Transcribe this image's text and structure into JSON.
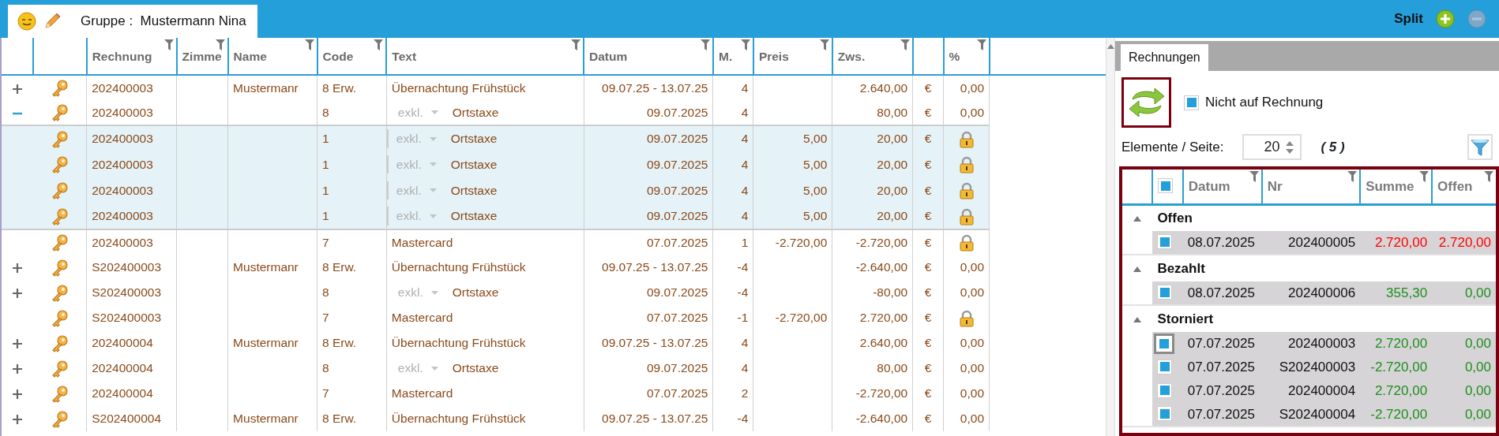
{
  "tab": {
    "title": "Gruppe :  Mustermann Nina"
  },
  "toolbar": {
    "label": "Split",
    "buttons": [
      {
        "kind": "add",
        "disabled": false
      },
      {
        "kind": "remove",
        "disabled": true
      }
    ]
  },
  "grid": {
    "columns": [
      {
        "filter": false
      },
      {
        "filter": false
      },
      {
        "label": "Rechnung",
        "filter": true
      },
      {
        "label": "Zimme",
        "filter": true
      },
      {
        "label": "Name",
        "filter": true
      },
      {
        "label": "Code",
        "filter": true
      },
      {
        "label": "Text",
        "filter": true
      },
      {
        "label": "Datum",
        "filter": true
      },
      {
        "label": "M.",
        "filter": true
      },
      {
        "label": "Preis",
        "filter": true
      },
      {
        "label": "Zws.",
        "filter": true
      },
      {
        "filter": false
      },
      {
        "label": "%",
        "filter": true
      }
    ],
    "rows": [
      {
        "kind": "expandable",
        "expanded": false,
        "rechnung": "202400003",
        "name": "Mustermanr",
        "code": "8 Erw.",
        "text": "Übernachtung Frühstück",
        "datum": "09.07.25 - 13.07.25",
        "m": "4",
        "zws": "2.640,00",
        "currency": "€",
        "percent": "0,00",
        "locked": false
      },
      {
        "kind": "expandable",
        "expanded": true,
        "rechnung": "202400003",
        "code": "8",
        "tax": "exkl.",
        "text": "Ortstaxe",
        "datum": "09.07.2025",
        "m": "4",
        "zws": "80,00",
        "currency": "€",
        "percent": "0,00",
        "locked": false,
        "children": [
          {
            "rechnung": "202400003",
            "code": "1",
            "tax": "exkl.",
            "text": "Ortstaxe",
            "datum": "09.07.2025",
            "m": "4",
            "preis": "5,00",
            "zws": "20,00",
            "currency": "€",
            "locked": true
          },
          {
            "rechnung": "202400003",
            "code": "1",
            "tax": "exkl.",
            "text": "Ortstaxe",
            "datum": "09.07.2025",
            "m": "4",
            "preis": "5,00",
            "zws": "20,00",
            "currency": "€",
            "locked": true
          },
          {
            "rechnung": "202400003",
            "code": "1",
            "tax": "exkl.",
            "text": "Ortstaxe",
            "datum": "09.07.2025",
            "m": "4",
            "preis": "5,00",
            "zws": "20,00",
            "currency": "€",
            "locked": true
          },
          {
            "rechnung": "202400003",
            "code": "1",
            "tax": "exkl.",
            "text": "Ortstaxe",
            "datum": "09.07.2025",
            "m": "4",
            "preis": "5,00",
            "zws": "20,00",
            "currency": "€",
            "locked": true
          }
        ]
      },
      {
        "kind": "plain",
        "rechnung": "202400003",
        "code": "7",
        "text": "Mastercard",
        "datum": "07.07.2025",
        "m": "1",
        "preis": "-2.720,00",
        "zws": "-2.720,00",
        "currency": "€",
        "locked": true
      },
      {
        "kind": "expandable",
        "expanded": false,
        "rechnung": "S202400003",
        "name": "Mustermanr",
        "code": "8 Erw.",
        "text": "Übernachtung Frühstück",
        "datum": "09.07.25 - 13.07.25",
        "m": "-4",
        "zws": "-2.640,00",
        "currency": "€",
        "percent": "0,00",
        "locked": false
      },
      {
        "kind": "expandable",
        "expanded": false,
        "rechnung": "S202400003",
        "code": "8",
        "tax": "exkl.",
        "text": "Ortstaxe",
        "datum": "09.07.2025",
        "m": "-4",
        "zws": "-80,00",
        "currency": "€",
        "percent": "0,00",
        "locked": false
      },
      {
        "kind": "plain",
        "rechnung": "S202400003",
        "code": "7",
        "text": "Mastercard",
        "datum": "07.07.2025",
        "m": "-1",
        "preis": "-2.720,00",
        "zws": "2.720,00",
        "currency": "€",
        "locked": true
      },
      {
        "kind": "expandable",
        "expanded": false,
        "rechnung": "202400004",
        "name": "Mustermanr",
        "code": "8 Erw.",
        "text": "Übernachtung Frühstück",
        "datum": "09.07.25 - 13.07.25",
        "m": "4",
        "zws": "2.640,00",
        "currency": "€",
        "percent": "0,00",
        "locked": false
      },
      {
        "kind": "expandable",
        "expanded": false,
        "rechnung": "202400004",
        "code": "8",
        "tax": "exkl.",
        "text": "Ortstaxe",
        "datum": "09.07.2025",
        "m": "4",
        "zws": "80,00",
        "currency": "€",
        "percent": "0,00",
        "locked": false
      },
      {
        "kind": "expandable",
        "expanded": false,
        "rechnung": "202400004",
        "code": "7",
        "text": "Mastercard",
        "datum": "07.07.2025",
        "m": "2",
        "zws": "-2.720,00",
        "currency": "€",
        "percent": "0,00",
        "locked": false
      },
      {
        "kind": "expandable",
        "expanded": false,
        "rechnung": "S202400004",
        "name": "Mustermanr",
        "code": "8 Erw.",
        "text": "Übernachtung Frühstück",
        "datum": "09.07.25 - 13.07.25",
        "m": "-4",
        "zws": "-2.640,00",
        "currency": "€",
        "percent": "0,00",
        "locked": false
      }
    ]
  },
  "panel": {
    "tabs": [
      {
        "label": "Rechnungen",
        "selected": true
      }
    ],
    "not_invoiced": {
      "label": "Nicht auf Rechnung",
      "checked": true
    },
    "page_size": {
      "label": "Elemente / Seite:",
      "value": "20",
      "count": "( 5 )"
    },
    "invoices": {
      "all_checked": true,
      "columns": [
        {
          "label": "Datum",
          "filter": true
        },
        {
          "label": "Nr",
          "filter": true
        },
        {
          "label": "Summe",
          "filter": true
        },
        {
          "label": "Offen",
          "filter": true
        }
      ],
      "groups": [
        {
          "name": "Offen",
          "expanded": true,
          "rows": [
            {
              "checked": true,
              "focused": false,
              "datum": "08.07.2025",
              "nr": "202400005",
              "summe": "2.720,00",
              "offen": "2.720,00",
              "color": "#ff0000"
            }
          ]
        },
        {
          "name": "Bezahlt",
          "expanded": true,
          "rows": [
            {
              "checked": true,
              "focused": false,
              "datum": "08.07.2025",
              "nr": "202400006",
              "summe": "355,30",
              "offen": "0,00",
              "color": "#1e8f1e"
            }
          ]
        },
        {
          "name": "Storniert",
          "expanded": true,
          "rows": [
            {
              "checked": true,
              "focused": true,
              "datum": "07.07.2025",
              "nr": "202400003",
              "summe": "2.720,00",
              "offen": "0,00",
              "color": "#1e8f1e"
            },
            {
              "checked": true,
              "focused": false,
              "datum": "07.07.2025",
              "nr": "S202400003",
              "summe": "-2.720,00",
              "offen": "0,00",
              "color": "#1e8f1e"
            },
            {
              "checked": true,
              "focused": false,
              "datum": "07.07.2025",
              "nr": "202400004",
              "summe": "2.720,00",
              "offen": "0,00",
              "color": "#1e8f1e"
            },
            {
              "checked": true,
              "focused": false,
              "datum": "07.07.2025",
              "nr": "S202400004",
              "summe": "-2.720,00",
              "offen": "0,00",
              "color": "#1e8f1e"
            }
          ]
        }
      ]
    }
  }
}
